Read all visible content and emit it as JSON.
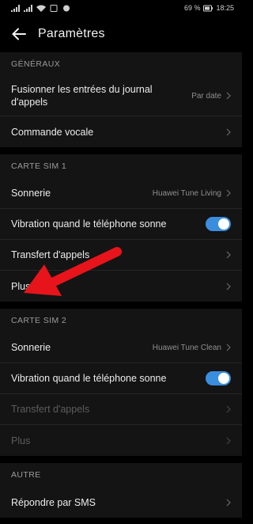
{
  "status": {
    "battery": "69 %",
    "time": "18:25"
  },
  "header": {
    "title": "Paramètres"
  },
  "sections": {
    "general": {
      "title": "GÉNÉRAUX",
      "merge_label": "Fusionner les entrées du journal d'appels",
      "merge_value": "Par date",
      "voice_label": "Commande vocale"
    },
    "sim1": {
      "title": "CARTE SIM 1",
      "ringtone_label": "Sonnerie",
      "ringtone_value": "Huawei Tune Living",
      "vibrate_label": "Vibration quand le téléphone sonne",
      "vibrate_on": true,
      "forward_label": "Transfert d'appels",
      "more_label": "Plus"
    },
    "sim2": {
      "title": "CARTE SIM 2",
      "ringtone_label": "Sonnerie",
      "ringtone_value": "Huawei Tune Clean",
      "vibrate_label": "Vibration quand le téléphone sonne",
      "vibrate_on": true,
      "forward_label": "Transfert d'appels",
      "more_label": "Plus"
    },
    "other": {
      "title": "AUTRE",
      "sms_label": "Répondre par SMS"
    }
  },
  "colors": {
    "accent": "#3b8dde",
    "annotation_arrow": "#e8141b",
    "background": "#000000",
    "card": "#141414"
  }
}
